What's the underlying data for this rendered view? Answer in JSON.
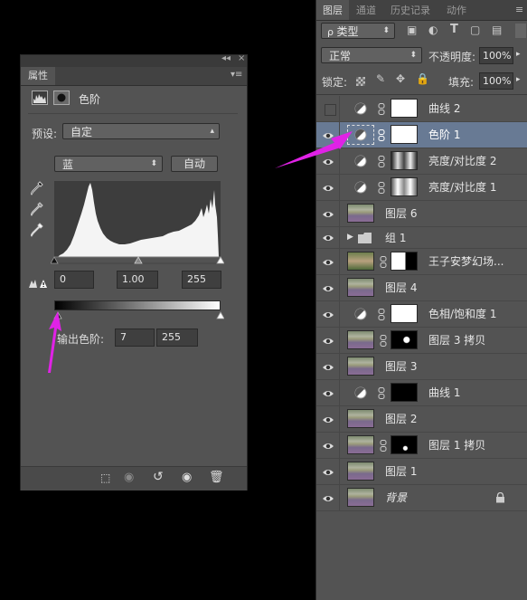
{
  "properties": {
    "tab_label": "属性",
    "title": "色阶",
    "preset_label": "预设:",
    "preset_value": "自定",
    "channel_value": "蓝",
    "auto_button": "自动",
    "input_black": "0",
    "input_gamma": "1.00",
    "input_white": "255",
    "output_label": "输出色阶:",
    "output_black": "7",
    "output_white": "255"
  },
  "layers": {
    "tabs": [
      "图层",
      "通道",
      "历史记录",
      "动作"
    ],
    "filter_kind": "类型",
    "blend_mode": "正常",
    "opacity_label": "不透明度:",
    "opacity_value": "100%",
    "lock_label": "锁定:",
    "fill_label": "填充:",
    "fill_value": "100%",
    "items": [
      {
        "name": "曲线 2",
        "visible": false
      },
      {
        "name": "色阶 1",
        "visible": true,
        "selected": true
      },
      {
        "name": "亮度/对比度 2",
        "visible": true
      },
      {
        "name": "亮度/对比度 1",
        "visible": true
      },
      {
        "name": "图层 6",
        "visible": true
      },
      {
        "name": "组 1",
        "visible": true
      },
      {
        "name": "王子安梦幻场...",
        "visible": true
      },
      {
        "name": "图层 4",
        "visible": true
      },
      {
        "name": "色相/饱和度 1",
        "visible": true
      },
      {
        "name": "图层 3 拷贝",
        "visible": true
      },
      {
        "name": "图层 3",
        "visible": true
      },
      {
        "name": "曲线 1",
        "visible": true
      },
      {
        "name": "图层 2",
        "visible": true
      },
      {
        "name": "图层 1 拷贝",
        "visible": true
      },
      {
        "name": "图层 1",
        "visible": true
      },
      {
        "name": "背景",
        "visible": true
      }
    ]
  },
  "colors": {
    "arrow": "#e022e6",
    "selection": "#687a94"
  }
}
